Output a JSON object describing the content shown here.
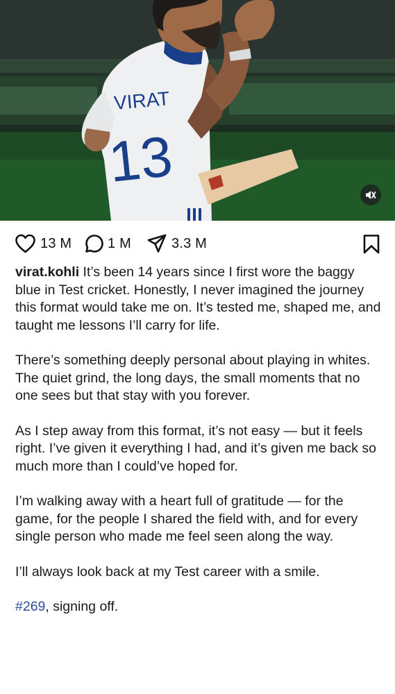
{
  "post": {
    "media": {
      "jersey_name": "VIRAT",
      "jersey_number": "13",
      "mute_icon": "speaker-muted-icon"
    },
    "actions": {
      "likes": "13 M",
      "comments": "1 M",
      "shares": "3.3 M",
      "icons": [
        "heart-icon",
        "comment-icon",
        "send-icon",
        "bookmark-icon"
      ]
    },
    "caption": {
      "username": "virat.kohli",
      "paragraph_1": "It’s been 14 years since I first wore the baggy blue in Test cricket. Honestly, I never imagined the journey this format would take me on. It’s tested me, shaped me, and taught me lessons I’ll carry for life.",
      "paragraph_2": "There’s something deeply personal about playing in whites. The quiet grind, the long days, the small moments that no one sees but that stay with you forever.",
      "paragraph_3": "As I step away from this format, it’s not easy — but it feels right. I’ve given it everything I had, and it’s given me back so much more than I could’ve hoped for.",
      "paragraph_4": "I’m walking away with a heart full of gratitude — for the game, for the people I shared the field with, and for every single person who made me feel seen along the way.",
      "paragraph_5": "I’ll always look back at my Test career with a smile.",
      "hashtag": "#269",
      "signoff": ", signing off."
    }
  },
  "colors": {
    "hashtag": "#2b4e9e",
    "text": "#1a1a1a",
    "icon": "#111111"
  }
}
